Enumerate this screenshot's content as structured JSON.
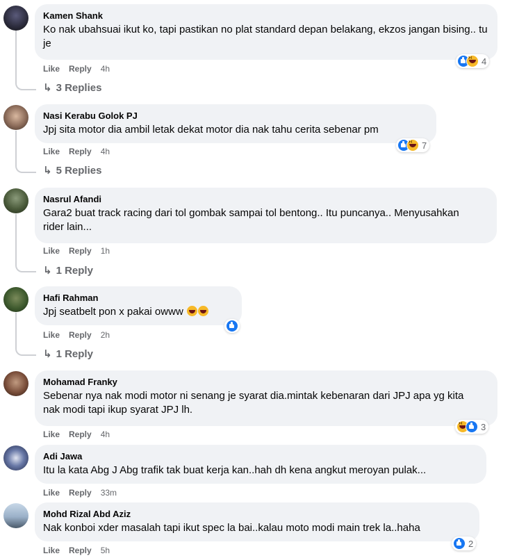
{
  "actions": {
    "like": "Like",
    "reply": "Reply"
  },
  "comments": [
    {
      "author": "Kamen Shank",
      "text": "Ko nak ubahsuai ikut ko, tapi pastikan no plat standard depan belakang, ekzos jangan bising.. tu je",
      "time": "4h",
      "reaction_count": "4",
      "reactions": [
        "like-icon",
        "haha-icon"
      ],
      "replies": "3 Replies"
    },
    {
      "author": "Nasi Kerabu Golok PJ",
      "text": "Jpj sita motor dia ambil letak dekat motor dia nak tahu cerita sebenar pm",
      "time": "4h",
      "reaction_count": "7",
      "reactions": [
        "like-icon",
        "haha-icon"
      ],
      "replies": "5 Replies"
    },
    {
      "author": "Nasrul Afandi",
      "text": "Gara2 buat track racing dari tol gombak sampai tol bentong.. Itu puncanya.. Menyusahkan rider lain...",
      "time": "1h",
      "replies": "1 Reply"
    },
    {
      "author": "Hafi Rahman",
      "text": "Jpj seatbelt pon x pakai owww",
      "time": "2h",
      "reactions": [
        "like-icon"
      ],
      "replies": "1 Reply"
    },
    {
      "author": "Mohamad Franky",
      "text": "Sebenar nya nak modi motor ni senang je syarat dia.mintak kebenaran dari JPJ apa yg kita nak modi tapi ikup syarat JPJ lh.",
      "time": "4h",
      "reaction_count": "3",
      "reactions": [
        "haha-icon",
        "like-icon"
      ]
    },
    {
      "author": "Adi Jawa",
      "text": "Itu la kata Abg J Abg trafik tak buat kerja kan..hah dh kena angkut meroyan pulak...",
      "time": "33m"
    },
    {
      "author": "Mohd Rizal Abd Aziz",
      "text": "Nak konboi xder masalah tapi ikut spec la bai..kalau moto modi main trek la..haha",
      "time": "5h",
      "reaction_count": "2",
      "reactions": [
        "like-icon"
      ]
    }
  ]
}
